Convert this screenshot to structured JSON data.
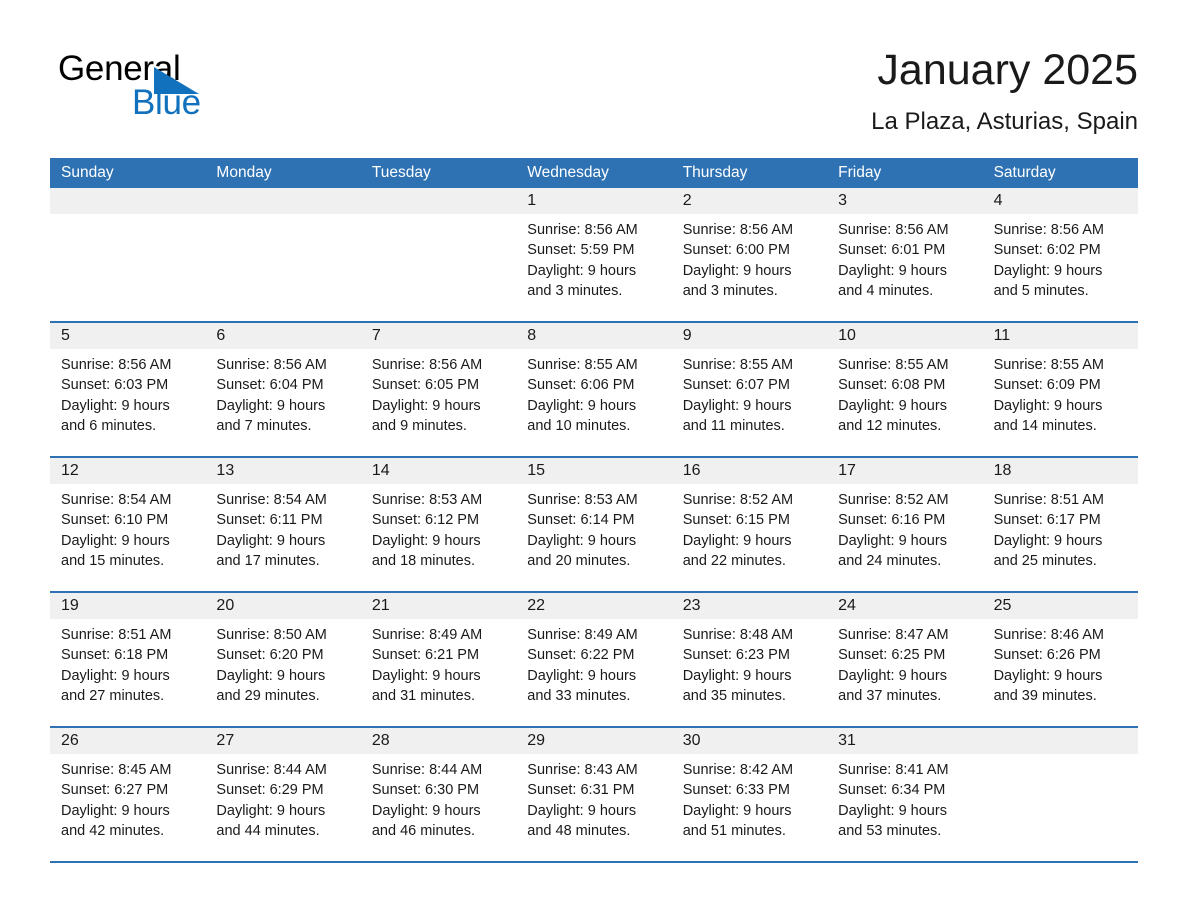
{
  "brand": {
    "name_part1": "General",
    "name_part2": "Blue",
    "mark": "triangle-logo",
    "color_black": "#000000",
    "color_blue": "#1271bd"
  },
  "header": {
    "title": "January 2025",
    "subtitle": "La Plaza, Asturias, Spain"
  },
  "theme": {
    "header_blue": "#2e72b4",
    "daynum_band": "#f0f0f0",
    "page_background": "#ffffff",
    "text": "#1a1a1a"
  },
  "calendar": {
    "weekdays": [
      "Sunday",
      "Monday",
      "Tuesday",
      "Wednesday",
      "Thursday",
      "Friday",
      "Saturday"
    ],
    "weeks": [
      [
        {
          "day": "",
          "sunrise": "",
          "sunset": "",
          "daylight_line1": "",
          "daylight_line2": "",
          "empty": true
        },
        {
          "day": "",
          "sunrise": "",
          "sunset": "",
          "daylight_line1": "",
          "daylight_line2": "",
          "empty": true
        },
        {
          "day": "",
          "sunrise": "",
          "sunset": "",
          "daylight_line1": "",
          "daylight_line2": "",
          "empty": true
        },
        {
          "day": "1",
          "sunrise": "Sunrise: 8:56 AM",
          "sunset": "Sunset: 5:59 PM",
          "daylight_line1": "Daylight: 9 hours",
          "daylight_line2": "and 3 minutes."
        },
        {
          "day": "2",
          "sunrise": "Sunrise: 8:56 AM",
          "sunset": "Sunset: 6:00 PM",
          "daylight_line1": "Daylight: 9 hours",
          "daylight_line2": "and 3 minutes."
        },
        {
          "day": "3",
          "sunrise": "Sunrise: 8:56 AM",
          "sunset": "Sunset: 6:01 PM",
          "daylight_line1": "Daylight: 9 hours",
          "daylight_line2": "and 4 minutes."
        },
        {
          "day": "4",
          "sunrise": "Sunrise: 8:56 AM",
          "sunset": "Sunset: 6:02 PM",
          "daylight_line1": "Daylight: 9 hours",
          "daylight_line2": "and 5 minutes."
        }
      ],
      [
        {
          "day": "5",
          "sunrise": "Sunrise: 8:56 AM",
          "sunset": "Sunset: 6:03 PM",
          "daylight_line1": "Daylight: 9 hours",
          "daylight_line2": "and 6 minutes."
        },
        {
          "day": "6",
          "sunrise": "Sunrise: 8:56 AM",
          "sunset": "Sunset: 6:04 PM",
          "daylight_line1": "Daylight: 9 hours",
          "daylight_line2": "and 7 minutes."
        },
        {
          "day": "7",
          "sunrise": "Sunrise: 8:56 AM",
          "sunset": "Sunset: 6:05 PM",
          "daylight_line1": "Daylight: 9 hours",
          "daylight_line2": "and 9 minutes."
        },
        {
          "day": "8",
          "sunrise": "Sunrise: 8:55 AM",
          "sunset": "Sunset: 6:06 PM",
          "daylight_line1": "Daylight: 9 hours",
          "daylight_line2": "and 10 minutes."
        },
        {
          "day": "9",
          "sunrise": "Sunrise: 8:55 AM",
          "sunset": "Sunset: 6:07 PM",
          "daylight_line1": "Daylight: 9 hours",
          "daylight_line2": "and 11 minutes."
        },
        {
          "day": "10",
          "sunrise": "Sunrise: 8:55 AM",
          "sunset": "Sunset: 6:08 PM",
          "daylight_line1": "Daylight: 9 hours",
          "daylight_line2": "and 12 minutes."
        },
        {
          "day": "11",
          "sunrise": "Sunrise: 8:55 AM",
          "sunset": "Sunset: 6:09 PM",
          "daylight_line1": "Daylight: 9 hours",
          "daylight_line2": "and 14 minutes."
        }
      ],
      [
        {
          "day": "12",
          "sunrise": "Sunrise: 8:54 AM",
          "sunset": "Sunset: 6:10 PM",
          "daylight_line1": "Daylight: 9 hours",
          "daylight_line2": "and 15 minutes."
        },
        {
          "day": "13",
          "sunrise": "Sunrise: 8:54 AM",
          "sunset": "Sunset: 6:11 PM",
          "daylight_line1": "Daylight: 9 hours",
          "daylight_line2": "and 17 minutes."
        },
        {
          "day": "14",
          "sunrise": "Sunrise: 8:53 AM",
          "sunset": "Sunset: 6:12 PM",
          "daylight_line1": "Daylight: 9 hours",
          "daylight_line2": "and 18 minutes."
        },
        {
          "day": "15",
          "sunrise": "Sunrise: 8:53 AM",
          "sunset": "Sunset: 6:14 PM",
          "daylight_line1": "Daylight: 9 hours",
          "daylight_line2": "and 20 minutes."
        },
        {
          "day": "16",
          "sunrise": "Sunrise: 8:52 AM",
          "sunset": "Sunset: 6:15 PM",
          "daylight_line1": "Daylight: 9 hours",
          "daylight_line2": "and 22 minutes."
        },
        {
          "day": "17",
          "sunrise": "Sunrise: 8:52 AM",
          "sunset": "Sunset: 6:16 PM",
          "daylight_line1": "Daylight: 9 hours",
          "daylight_line2": "and 24 minutes."
        },
        {
          "day": "18",
          "sunrise": "Sunrise: 8:51 AM",
          "sunset": "Sunset: 6:17 PM",
          "daylight_line1": "Daylight: 9 hours",
          "daylight_line2": "and 25 minutes."
        }
      ],
      [
        {
          "day": "19",
          "sunrise": "Sunrise: 8:51 AM",
          "sunset": "Sunset: 6:18 PM",
          "daylight_line1": "Daylight: 9 hours",
          "daylight_line2": "and 27 minutes."
        },
        {
          "day": "20",
          "sunrise": "Sunrise: 8:50 AM",
          "sunset": "Sunset: 6:20 PM",
          "daylight_line1": "Daylight: 9 hours",
          "daylight_line2": "and 29 minutes."
        },
        {
          "day": "21",
          "sunrise": "Sunrise: 8:49 AM",
          "sunset": "Sunset: 6:21 PM",
          "daylight_line1": "Daylight: 9 hours",
          "daylight_line2": "and 31 minutes."
        },
        {
          "day": "22",
          "sunrise": "Sunrise: 8:49 AM",
          "sunset": "Sunset: 6:22 PM",
          "daylight_line1": "Daylight: 9 hours",
          "daylight_line2": "and 33 minutes."
        },
        {
          "day": "23",
          "sunrise": "Sunrise: 8:48 AM",
          "sunset": "Sunset: 6:23 PM",
          "daylight_line1": "Daylight: 9 hours",
          "daylight_line2": "and 35 minutes."
        },
        {
          "day": "24",
          "sunrise": "Sunrise: 8:47 AM",
          "sunset": "Sunset: 6:25 PM",
          "daylight_line1": "Daylight: 9 hours",
          "daylight_line2": "and 37 minutes."
        },
        {
          "day": "25",
          "sunrise": "Sunrise: 8:46 AM",
          "sunset": "Sunset: 6:26 PM",
          "daylight_line1": "Daylight: 9 hours",
          "daylight_line2": "and 39 minutes."
        }
      ],
      [
        {
          "day": "26",
          "sunrise": "Sunrise: 8:45 AM",
          "sunset": "Sunset: 6:27 PM",
          "daylight_line1": "Daylight: 9 hours",
          "daylight_line2": "and 42 minutes."
        },
        {
          "day": "27",
          "sunrise": "Sunrise: 8:44 AM",
          "sunset": "Sunset: 6:29 PM",
          "daylight_line1": "Daylight: 9 hours",
          "daylight_line2": "and 44 minutes."
        },
        {
          "day": "28",
          "sunrise": "Sunrise: 8:44 AM",
          "sunset": "Sunset: 6:30 PM",
          "daylight_line1": "Daylight: 9 hours",
          "daylight_line2": "and 46 minutes."
        },
        {
          "day": "29",
          "sunrise": "Sunrise: 8:43 AM",
          "sunset": "Sunset: 6:31 PM",
          "daylight_line1": "Daylight: 9 hours",
          "daylight_line2": "and 48 minutes."
        },
        {
          "day": "30",
          "sunrise": "Sunrise: 8:42 AM",
          "sunset": "Sunset: 6:33 PM",
          "daylight_line1": "Daylight: 9 hours",
          "daylight_line2": "and 51 minutes."
        },
        {
          "day": "31",
          "sunrise": "Sunrise: 8:41 AM",
          "sunset": "Sunset: 6:34 PM",
          "daylight_line1": "Daylight: 9 hours",
          "daylight_line2": "and 53 minutes."
        },
        {
          "day": "",
          "sunrise": "",
          "sunset": "",
          "daylight_line1": "",
          "daylight_line2": "",
          "empty": true
        }
      ]
    ]
  }
}
